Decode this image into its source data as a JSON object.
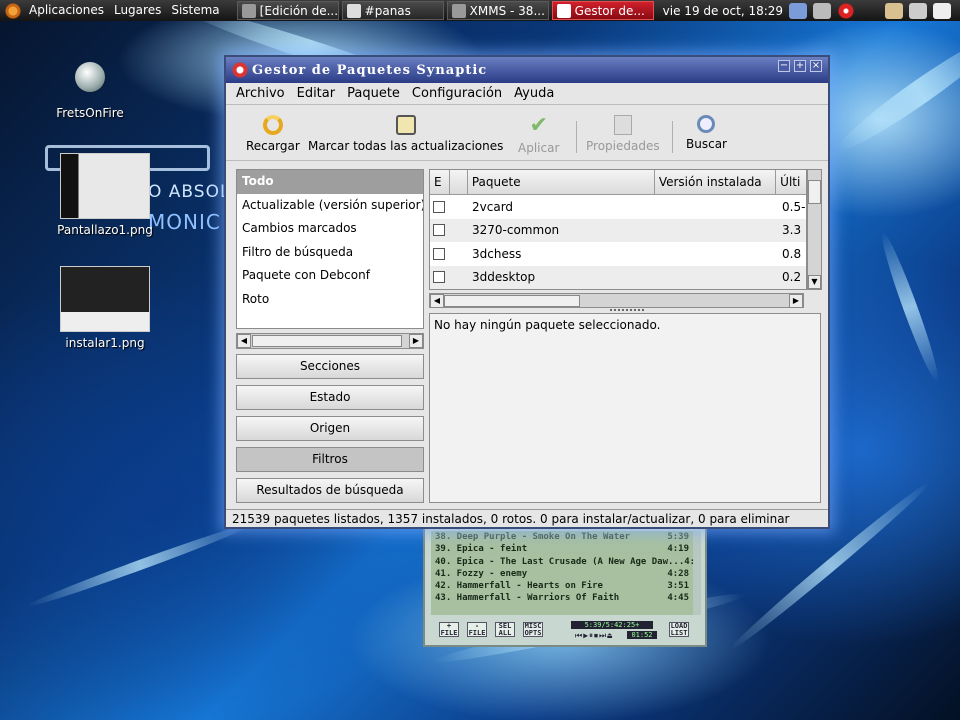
{
  "panel": {
    "menus": [
      "Aplicaciones",
      "Lugares",
      "Sistema"
    ],
    "tasks": [
      {
        "label": "[Edición de..."
      },
      {
        "label": "#panas"
      },
      {
        "label": "XMMS - 38..."
      },
      {
        "label": "Gestor de..."
      }
    ],
    "clock": "vie 19 de oct, 18:29"
  },
  "desktop": {
    "icons": [
      {
        "label": "FretsOnFire"
      },
      {
        "label": "Pantallazo1.png"
      },
      {
        "label": "instalar1.png"
      }
    ],
    "wallpaper_text": [
      "O ABSOL",
      "MONIC"
    ]
  },
  "xmms": {
    "playlist": [
      {
        "title": "38. Deep Purple - Smoke On The Water",
        "time": "5:39"
      },
      {
        "title": "39. Epica - feint",
        "time": "4:19"
      },
      {
        "title": "40. Epica - The Last Crusade (A New Age Daw...",
        "time": "4:22"
      },
      {
        "title": "41. Fozzy - enemy",
        "time": "4:28"
      },
      {
        "title": "42. Hammerfall - Hearts on Fire",
        "time": "3:51"
      },
      {
        "title": "43. Hammerfall - Warriors Of Faith",
        "time": "4:45"
      }
    ],
    "buttons": [
      {
        "top": "+",
        "bottom": "FILE"
      },
      {
        "top": "-",
        "bottom": "FILE"
      },
      {
        "top": "SEL",
        "bottom": "ALL"
      },
      {
        "top": "MISC",
        "bottom": "OPTS"
      },
      {
        "top": "LOAD",
        "bottom": "LIST"
      }
    ],
    "total_time": "5:39/5:42:25+",
    "elapsed": "01:52"
  },
  "synaptic": {
    "title": "Gestor de Paquetes Synaptic",
    "menu": [
      "Archivo",
      "Editar",
      "Paquete",
      "Configuración",
      "Ayuda"
    ],
    "toolbar": {
      "reload": "Recargar",
      "mark_all": "Marcar todas las actualizaciones",
      "apply": "Aplicar",
      "properties": "Propiedades",
      "search": "Buscar"
    },
    "filters": [
      "Todo",
      "Actualizable (versión superior)",
      "Cambios marcados",
      "Filtro de búsqueda",
      "Paquete con Debconf",
      "Roto"
    ],
    "filter_buttons": [
      "Secciones",
      "Estado",
      "Origen",
      "Filtros",
      "Resultados de búsqueda"
    ],
    "columns": [
      "E",
      "",
      "Paquete",
      "Versión instalada",
      "Últi"
    ],
    "packages": [
      {
        "name": "2vcard",
        "latest": "0.5-"
      },
      {
        "name": "3270-common",
        "latest": "3.3"
      },
      {
        "name": "3dchess",
        "latest": "0.8"
      },
      {
        "name": "3ddesktop",
        "latest": "0.2"
      }
    ],
    "details": "No hay ningún paquete seleccionado.",
    "status": "21539 paquetes listados, 1357 instalados, 0 rotos. 0 para instalar/actualizar, 0 para eliminar"
  }
}
